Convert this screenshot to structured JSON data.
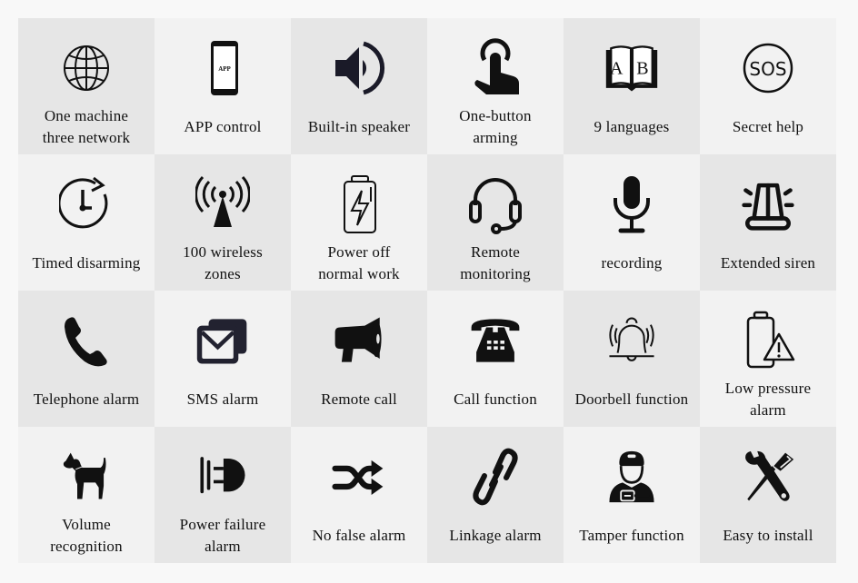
{
  "colors": {
    "cell_dark": "#e6e6e6",
    "cell_light": "#f2f2f2",
    "icon": "#111111",
    "background": "#f8f8f8"
  },
  "features": [
    {
      "label": "One machine\nthree network",
      "icon": "globe-icon"
    },
    {
      "label": "APP control",
      "icon": "smartphone-app-icon",
      "icon_text": "APP"
    },
    {
      "label": "Built-in speaker",
      "icon": "speaker-icon"
    },
    {
      "label": "One-button\narming",
      "icon": "touch-finger-icon"
    },
    {
      "label": "9 languages",
      "icon": "open-book-icon",
      "icon_text": "A B"
    },
    {
      "label": "Secret help",
      "icon": "sos-icon",
      "icon_text": "SOS"
    },
    {
      "label": "Timed disarming",
      "icon": "clock-refresh-icon"
    },
    {
      "label": "100 wireless\nzones",
      "icon": "antenna-signal-icon"
    },
    {
      "label": "Power off\nnormal work",
      "icon": "battery-charging-icon"
    },
    {
      "label": "Remote\nmonitoring",
      "icon": "headset-icon"
    },
    {
      "label": "recording",
      "icon": "microphone-icon"
    },
    {
      "label": "Extended siren",
      "icon": "siren-light-icon"
    },
    {
      "label": "Telephone alarm",
      "icon": "phone-handset-icon"
    },
    {
      "label": "SMS alarm",
      "icon": "envelopes-icon"
    },
    {
      "label": "Remote call",
      "icon": "megaphone-icon"
    },
    {
      "label": "Call function",
      "icon": "desk-telephone-icon"
    },
    {
      "label": "Doorbell function",
      "icon": "ringing-bell-icon"
    },
    {
      "label": "Low pressure\nalarm",
      "icon": "low-battery-warning-icon"
    },
    {
      "label": "Volume\nrecognition",
      "icon": "dog-icon"
    },
    {
      "label": "Power failure\nalarm",
      "icon": "power-plug-icon"
    },
    {
      "label": "No false alarm",
      "icon": "shuffle-arrows-icon"
    },
    {
      "label": "Linkage alarm",
      "icon": "chain-link-icon"
    },
    {
      "label": "Tamper function",
      "icon": "technician-icon"
    },
    {
      "label": "Easy to install",
      "icon": "wrench-screwdriver-icon"
    }
  ]
}
